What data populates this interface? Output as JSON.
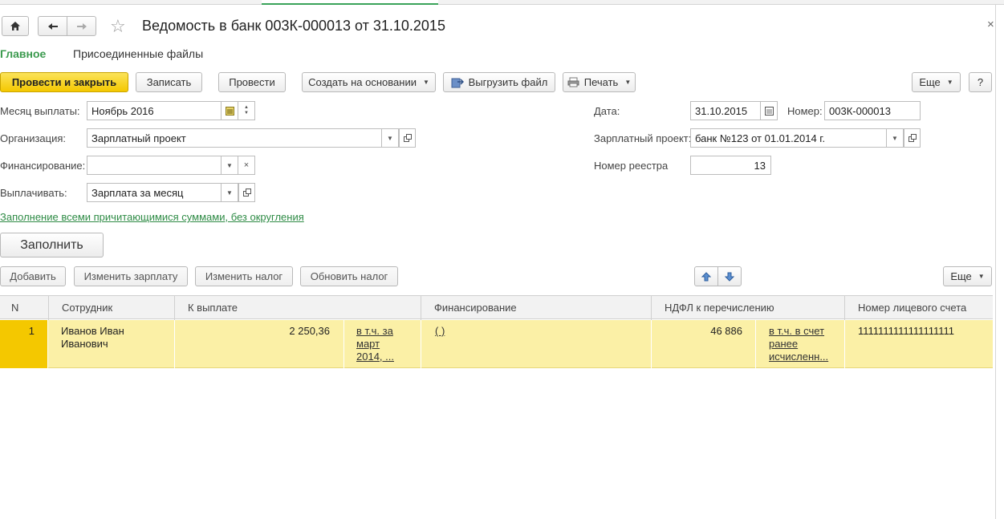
{
  "window": {
    "title": "Ведомость в банк 003К-000013 от 31.10.2015",
    "close_glyph": "×"
  },
  "nav": {
    "home_icon": "home-icon",
    "back_icon": "arrow-left-icon",
    "forward_icon": "arrow-right-icon",
    "favorite_icon": "star-icon"
  },
  "tabs": [
    {
      "label": "Главное",
      "active": true
    },
    {
      "label": "Присоединенные файлы",
      "active": false
    }
  ],
  "toolbar": {
    "post_close": "Провести и закрыть",
    "save": "Записать",
    "post": "Провести",
    "create_based": "Создать на основании",
    "export_file": "Выгрузить файл",
    "print": "Печать",
    "more": "Еще",
    "help": "?"
  },
  "form": {
    "month_label": "Месяц выплаты:",
    "month_value": "Ноябрь 2016",
    "org_label": "Организация:",
    "org_value": "Зарплатный проект",
    "finance_label": "Финансирование:",
    "finance_value": "",
    "pay_label": "Выплачивать:",
    "pay_value": "Зарплата за месяц",
    "date_label": "Дата:",
    "date_value": "31.10.2015",
    "number_label": "Номер:",
    "number_value": "003К-000013",
    "salary_project_label": "Зарплатный проект:",
    "salary_project_value": "банк №123 от 01.01.2014 г.",
    "registry_label": "Номер реестра",
    "registry_value": "13",
    "fill_mode_link": "Заполнение всеми причитающимися суммами, без округления",
    "fill_button": "Заполнить"
  },
  "table_toolbar": {
    "add": "Добавить",
    "change_salary": "Изменить зарплату",
    "change_tax": "Изменить налог",
    "update_tax": "Обновить налог",
    "more": "Еще"
  },
  "table": {
    "columns": [
      "N",
      "Сотрудник",
      "К выплате",
      "Финансирование",
      "НДФЛ к перечислению",
      "Номер лицевого счета"
    ],
    "rows": [
      {
        "n": "1",
        "employee": "Иванов Иван Иванович",
        "amount": "2 250,36",
        "amount_note": "в т.ч. за март 2014, ...",
        "financing": "(     )",
        "tax": "46 886",
        "tax_note": "в т.ч. в счет ранее исчисленн...",
        "account": "1111111111111111111"
      }
    ]
  },
  "colors": {
    "accent_green": "#3b9a4e",
    "primary_button": "#f4c800",
    "selected_row": "#fbf0a6"
  }
}
